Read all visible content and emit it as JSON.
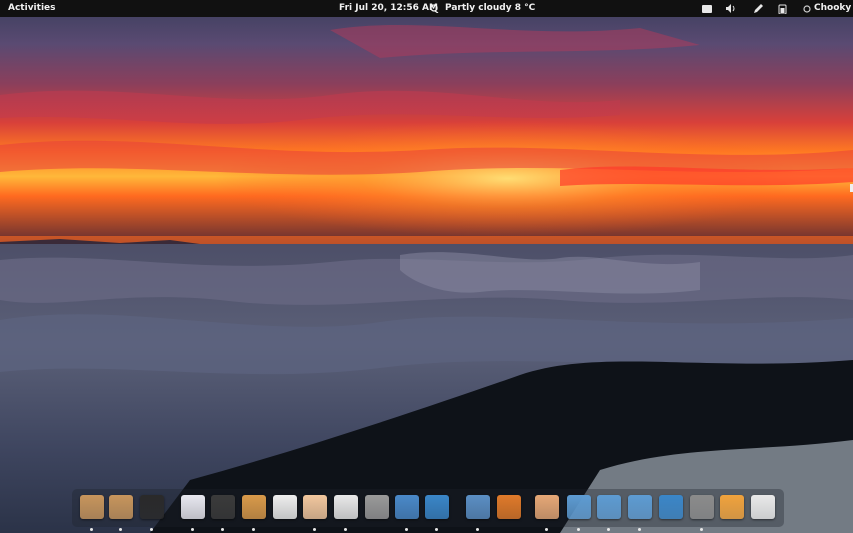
{
  "topbar": {
    "activities_label": "Activities",
    "clock": "Fri Jul 20, 12:56 AM",
    "weather": "Partly cloudy 8 °C",
    "weather_icon": "cloud-icon",
    "status_icons": [
      "folder-icon",
      "volume-icon",
      "pen-icon",
      "battery-icon"
    ],
    "user_name": "Chooky",
    "user_icon": "user-status-icon"
  },
  "dock": {
    "items": [
      {
        "name": "archive-manager-icon",
        "color": "#c7955c"
      },
      {
        "name": "software-install-icon",
        "color": "#c7955c"
      },
      {
        "name": "terminal-icon",
        "color": "#2a2a2a"
      },
      {
        "name": "solitaire-cards-icon",
        "color": "#e8e8f0"
      },
      {
        "name": "mahjongg-icon",
        "color": "#3b3b3b"
      },
      {
        "name": "paint-palette-icon",
        "color": "#d99a4a"
      },
      {
        "name": "text-editor-icon",
        "color": "#eeeeee"
      },
      {
        "name": "eye-viewer-icon",
        "color": "#f2c79e"
      },
      {
        "name": "help-lifebuoy-icon",
        "color": "#e9e9e9"
      },
      {
        "name": "calculator-icon",
        "color": "#9a9a9a"
      },
      {
        "name": "system-monitor-icon",
        "color": "#4a89c9"
      },
      {
        "name": "writer-document-icon",
        "color": "#3a86c8"
      },
      {
        "name": "magnifier-search-icon",
        "color": "#5b8fc4"
      },
      {
        "name": "firefox-browser-icon",
        "color": "#e07a2a"
      },
      {
        "name": "image-viewer-icon",
        "color": "#e6a877"
      },
      {
        "name": "folder-blue-icon",
        "color": "#5d9bd2"
      },
      {
        "name": "folder-documents-icon",
        "color": "#5d9bd2"
      },
      {
        "name": "folder-generic-icon",
        "color": "#5d9bd2"
      },
      {
        "name": "accessibility-icon",
        "color": "#3a86c8"
      },
      {
        "name": "trash-icon",
        "color": "#8b8b8b"
      },
      {
        "name": "audio-player-icon",
        "color": "#f0a23c"
      },
      {
        "name": "brightness-settings-icon",
        "color": "#e9e9e9"
      }
    ]
  }
}
